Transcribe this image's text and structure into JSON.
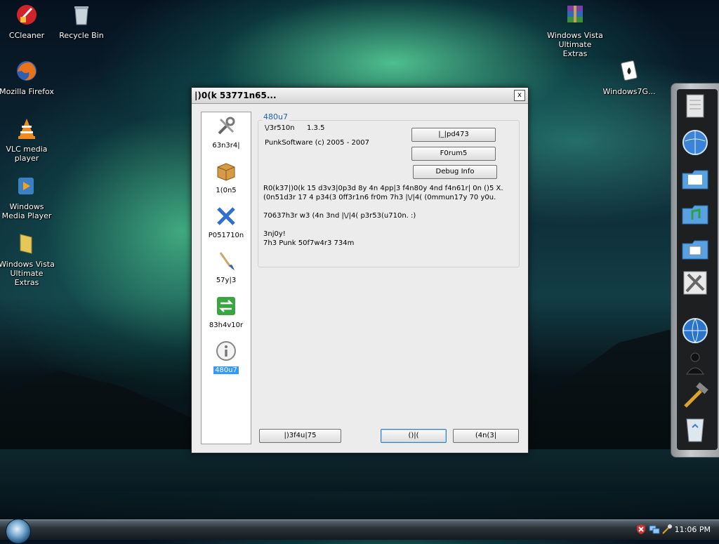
{
  "desktop": {
    "icons": [
      {
        "label": "CCleaner",
        "icon": "ccleaner-icon"
      },
      {
        "label": "Recycle Bin",
        "icon": "recycle-bin-icon"
      },
      {
        "label": "Mozilla Firefox",
        "icon": "firefox-icon"
      },
      {
        "label": "VLC media player",
        "icon": "vlc-icon"
      },
      {
        "label": "Windows Media Player",
        "icon": "media-player-icon"
      },
      {
        "label": "Windows Vista Ultimate Extras",
        "icon": "folder-icon"
      },
      {
        "label": "Windows Vista Ultimate Extras",
        "icon": "winrar-icon"
      },
      {
        "label": "Windows7G...",
        "icon": "card-game-icon"
      }
    ]
  },
  "dialog": {
    "title": "|)0(k 53771n65...",
    "close": "x",
    "sidebar": [
      {
        "label": "63n3r4|",
        "icon": "tools-icon"
      },
      {
        "label": "1(0n5",
        "icon": "box-icon"
      },
      {
        "label": "P051710n",
        "icon": "move-arrows-icon"
      },
      {
        "label": "57y|3",
        "icon": "brush-icon"
      },
      {
        "label": "83h4v10r",
        "icon": "arrows-swap-icon"
      },
      {
        "label": "480u7",
        "icon": "info-icon",
        "selected": true
      }
    ],
    "about": {
      "group_label": "480u7",
      "version_label": "\\/3r510n",
      "version_value": "1.3.5",
      "copyright": "PunkSoftware (c) 2005 - 2007",
      "buttons": [
        "|_|pd473",
        "F0rum5",
        "Debug Info"
      ],
      "body": [
        "R0(k37|)0(k 15 d3v3|0p3d 8y 4n 4pp|3 f4n80y 4nd f4n61r| 0n ()5 X.",
        "(0n51d3r 17 4 p34(3 0ff3r1n6 fr0m 7h3 |\\/|4( (0mmun17y 70 y0u.",
        "70637h3r w3 (4n 3nd |\\/|4( p3r53(u710n. :)",
        "3nj0y!",
        "7h3 Punk 50f7w4r3 734m"
      ]
    },
    "footer": {
      "default_btn": "|)3f4u|75",
      "ok_btn": "()|(",
      "cancel_btn": "(4n(3|"
    }
  },
  "taskbar": {
    "clock": "11:06 PM"
  }
}
